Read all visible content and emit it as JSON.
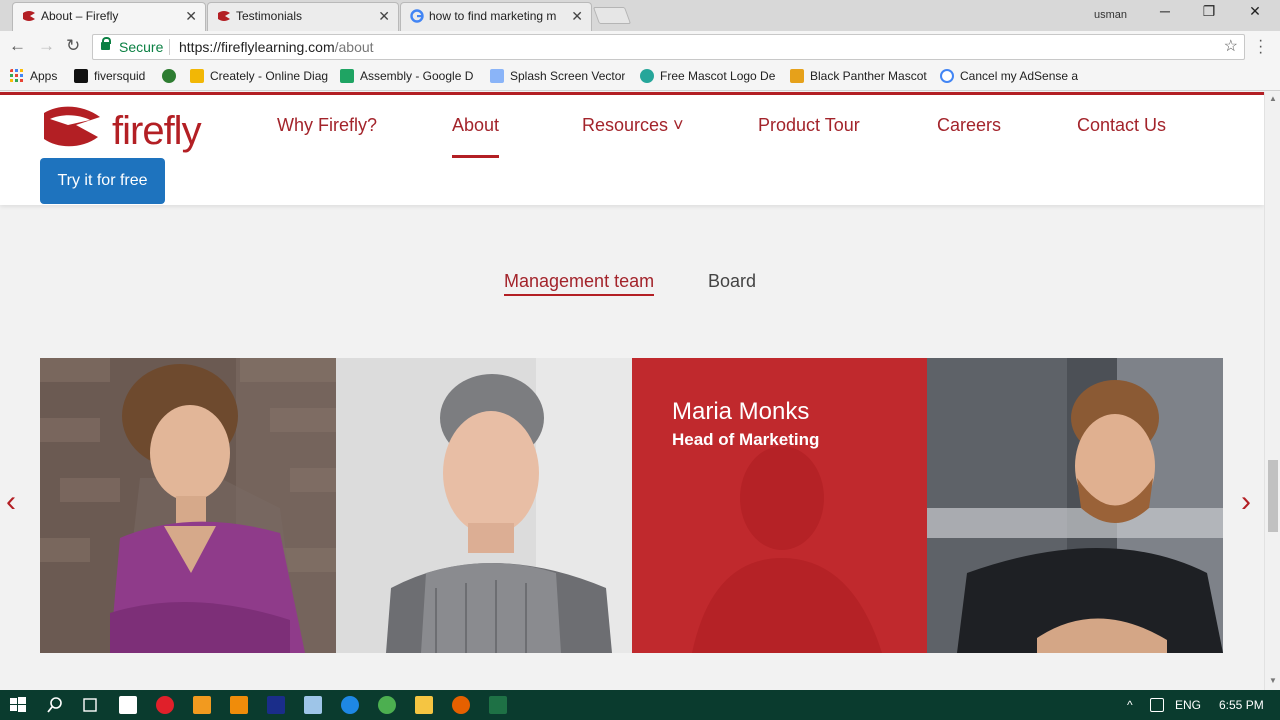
{
  "browser": {
    "tabs": [
      {
        "title": "About – Firefly",
        "active": true
      },
      {
        "title": "Testimonials",
        "active": false
      },
      {
        "title": "how to find marketing m",
        "active": false
      }
    ],
    "user": "usman",
    "secure_label": "Secure",
    "url_host": "https://fireflylearning.com",
    "url_path": "/about"
  },
  "bookmarks": [
    {
      "label": "Apps",
      "color": "#555555"
    },
    {
      "label": "fiversquid",
      "color": "#111111"
    },
    {
      "label": "",
      "color": "#2e7d32"
    },
    {
      "label": "Creately - Online Diag",
      "color": "#f2b705"
    },
    {
      "label": "Assembly - Google D",
      "color": "#1fa463"
    },
    {
      "label": "Splash Screen Vector",
      "color": "#8ab4f8"
    },
    {
      "label": "Free Mascot Logo De",
      "color": "#26a69a"
    },
    {
      "label": "Black Panther Mascot",
      "color": "#e6a11a"
    },
    {
      "label": "Cancel my AdSense a",
      "color": "#4285f4"
    }
  ],
  "site": {
    "logo_text": "firefly",
    "brand_color": "#b31f24",
    "nav": [
      {
        "label": "Why Firefly?"
      },
      {
        "label": "About"
      },
      {
        "label": "Resources ˅"
      },
      {
        "label": "Product Tour"
      },
      {
        "label": "Careers"
      },
      {
        "label": "Contact Us"
      }
    ],
    "cta": "Try it for free",
    "team_tabs": [
      "Management team",
      "Board"
    ],
    "highlight": {
      "name": "Maria Monks",
      "title": "Head of Marketing"
    },
    "prev_arrow": "‹",
    "next_arrow": "›"
  },
  "taskbar": {
    "lang": "ENG",
    "time": "6:55 PM"
  }
}
